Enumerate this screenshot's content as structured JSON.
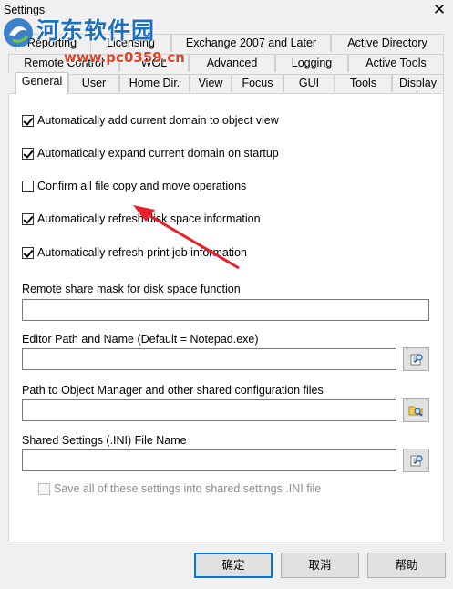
{
  "window": {
    "title": "Settings",
    "close_glyph": "✕"
  },
  "watermark": {
    "title": "河东软件园",
    "url": "www.pc0359.cn"
  },
  "tabs": {
    "row1": [
      "Reporting",
      "Licensing",
      "Exchange 2007 and Later",
      "Active Directory"
    ],
    "row2": [
      "Remote Control",
      "WOL",
      "Advanced",
      "Logging",
      "Active Tools"
    ],
    "row3": [
      "General",
      "User",
      "Home Dir.",
      "View",
      "Focus",
      "GUI",
      "Tools",
      "Display"
    ],
    "active": "General"
  },
  "general": {
    "checkboxes": [
      {
        "label": "Automatically add current domain to object view",
        "checked": true
      },
      {
        "label": "Automatically expand current domain on startup",
        "checked": true
      },
      {
        "label": "Confirm all file copy and move operations",
        "checked": false
      },
      {
        "label": "Automatically refresh disk space information",
        "checked": true
      },
      {
        "label": "Automatically refresh print job information",
        "checked": true
      }
    ],
    "fields": [
      {
        "label": "Remote share mask for disk space function",
        "value": "",
        "browse_icon": null
      },
      {
        "label": "Editor Path and Name (Default = Notepad.exe)",
        "value": "",
        "browse_icon": "browse-file-icon"
      },
      {
        "label": "Path to Object Manager and other shared configuration files",
        "value": "",
        "browse_icon": "browse-folder-icon"
      },
      {
        "label": "Shared Settings (.INI) File Name",
        "value": "",
        "browse_icon": "browse-file-icon"
      }
    ],
    "save_shared": {
      "label": "Save all of these settings into shared settings .INI file",
      "checked": false,
      "disabled": true
    }
  },
  "buttons": {
    "ok": "确定",
    "cancel": "取消",
    "help": "帮助"
  },
  "colors": {
    "accent": "#0078d7",
    "annotation_arrow": "#e8202a",
    "watermark_blue": "#1d6fc1",
    "watermark_red": "#e0412a"
  }
}
